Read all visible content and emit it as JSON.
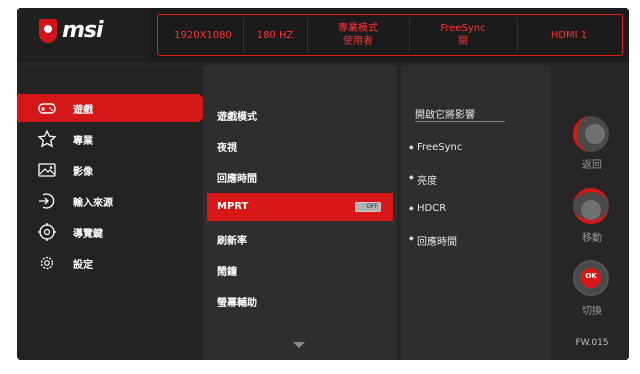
{
  "brand": "msi",
  "status": {
    "resolution": "1920X1080",
    "refresh": "180 HZ",
    "mode_line1": "專業模式",
    "mode_line2": "使用者",
    "freesync_line1": "FreeSync",
    "freesync_line2": "關",
    "input": "HDMI 1"
  },
  "menu": [
    {
      "label": "遊戲",
      "icon": "gamepad-icon",
      "active": true
    },
    {
      "label": "專業",
      "icon": "star-icon"
    },
    {
      "label": "影像",
      "icon": "image-icon"
    },
    {
      "label": "輸入來源",
      "icon": "input-source-icon"
    },
    {
      "label": "導覽鍵",
      "icon": "navi-key-icon"
    },
    {
      "label": "設定",
      "icon": "gear-icon"
    }
  ],
  "submenu": [
    {
      "label": "遊戲模式"
    },
    {
      "label": "夜視"
    },
    {
      "label": "回應時間"
    },
    {
      "label": "MPRT",
      "active": true,
      "toggle": "OFF"
    },
    {
      "label": "刷新率"
    },
    {
      "label": "鬧鐘"
    },
    {
      "label": "螢幕輔助"
    }
  ],
  "affected": {
    "title": "開啟它將影響",
    "items": [
      "FreeSync",
      "亮度",
      "HDCR",
      "回應時間"
    ]
  },
  "nav": {
    "back": "返回",
    "move": "移動",
    "ok": "OK",
    "switch": "切換",
    "firmware": "FW.015"
  },
  "colors": {
    "accent": "#d81818",
    "status_text": "#ff3030"
  }
}
